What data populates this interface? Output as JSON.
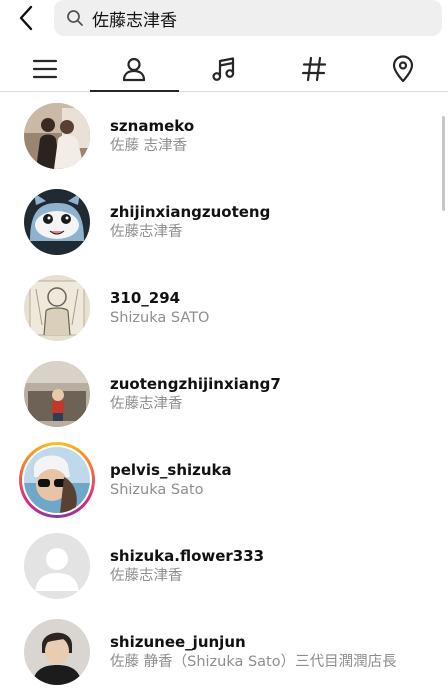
{
  "search": {
    "query": "佐藤志津香"
  },
  "tabs": [
    {
      "name": "top",
      "icon": "menu-lines-icon"
    },
    {
      "name": "accounts",
      "icon": "person-icon",
      "active": true
    },
    {
      "name": "audio",
      "icon": "music-note-icon"
    },
    {
      "name": "tags",
      "icon": "hashtag-icon"
    },
    {
      "name": "places",
      "icon": "location-pin-icon"
    }
  ],
  "results": [
    {
      "username": "sznameko",
      "fullname": "佐藤 志津香"
    },
    {
      "username": "zhijinxiangzuoteng",
      "fullname": "佐藤志津香"
    },
    {
      "username": "310_294",
      "fullname": "Shizuka SATO"
    },
    {
      "username": "zuotengzhijinxiang7",
      "fullname": "佐藤志津香"
    },
    {
      "username": "pelvis_shizuka",
      "fullname": "Shizuka Sato"
    },
    {
      "username": "shizuka.flower333",
      "fullname": "佐藤志津香"
    },
    {
      "username": "shizunee_junjun",
      "fullname": "佐藤 静香（Shizuka Sato）三代目潤潤店長"
    }
  ],
  "colors": {
    "accent": "#262626",
    "secondary_text": "#8e8e8e",
    "search_bg": "#efefef",
    "divider": "#dbdbdb"
  }
}
